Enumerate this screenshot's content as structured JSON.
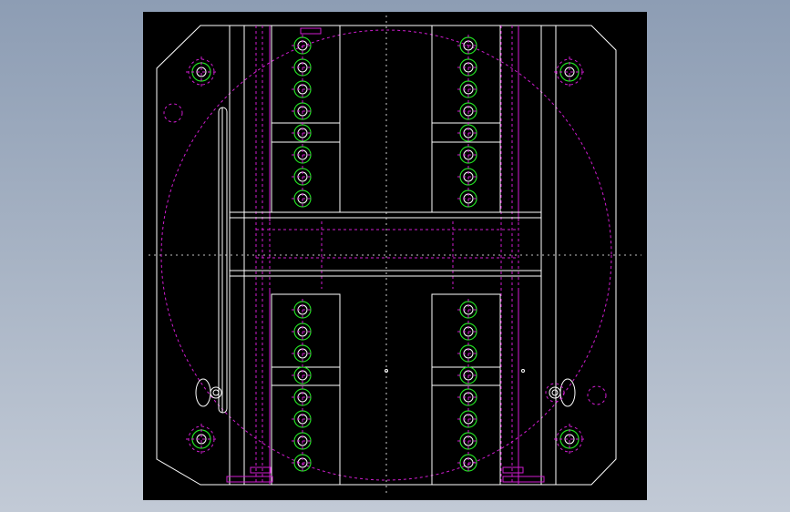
{
  "viewport": {
    "background": "#000000",
    "line_color": "#ffffff",
    "hidden_line_color": "#d01cd0",
    "hole_color": "#22dd22"
  },
  "hole_columns": [
    {
      "name": "upper-left",
      "count": 8
    },
    {
      "name": "upper-right",
      "count": 8
    },
    {
      "name": "lower-left",
      "count": 8
    },
    {
      "name": "lower-right",
      "count": 8
    }
  ],
  "corner_holes": [
    "top-left",
    "top-right",
    "bottom-left",
    "bottom-right"
  ]
}
